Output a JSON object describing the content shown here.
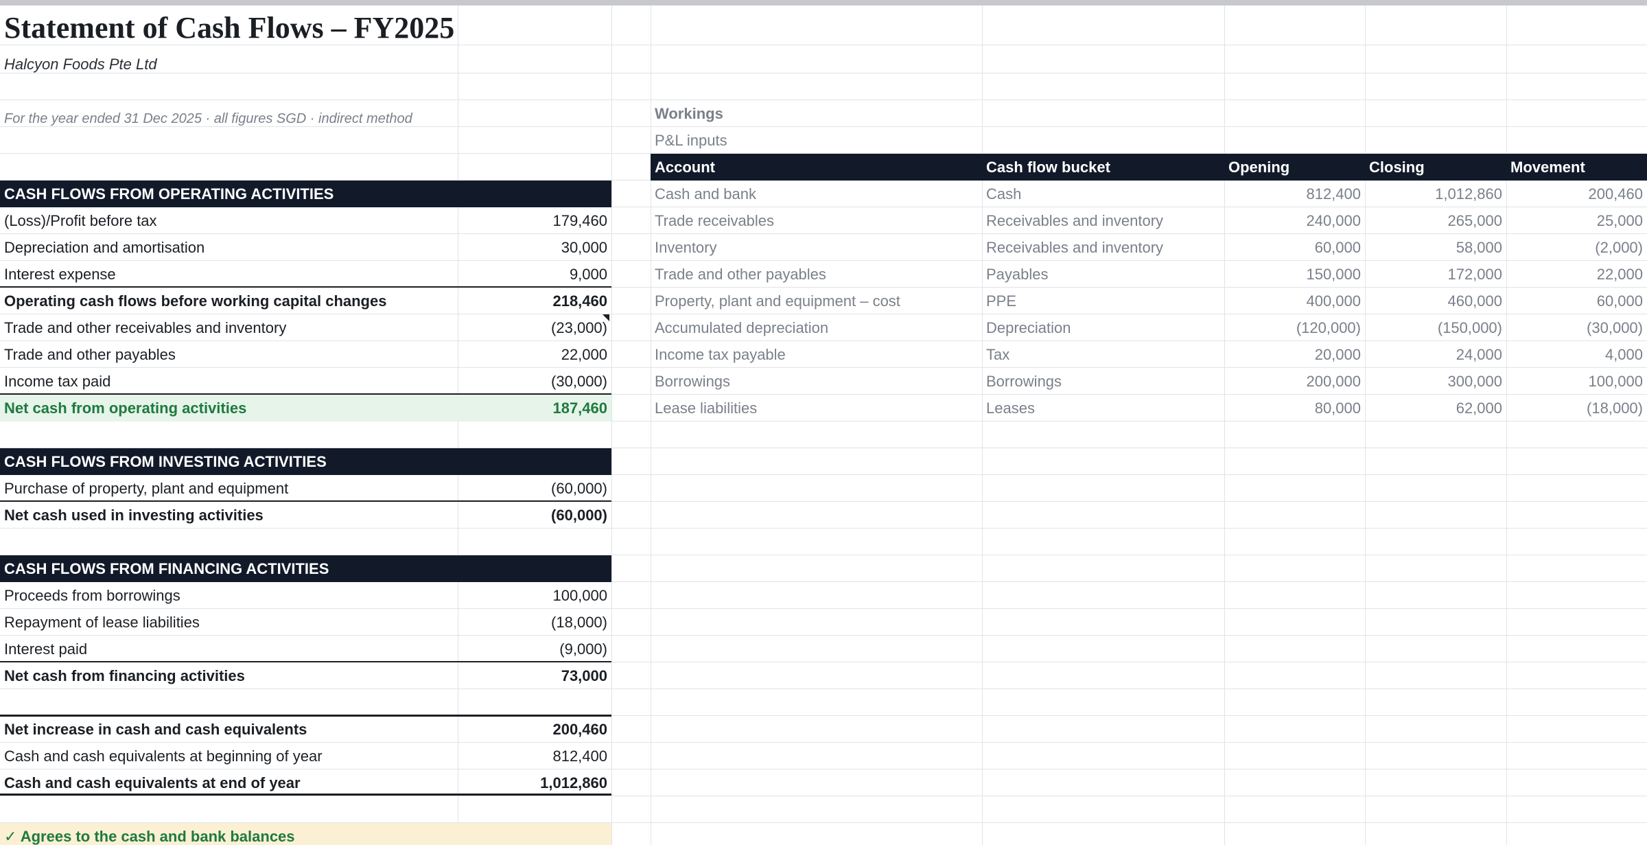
{
  "statement": {
    "title": "Statement of Cash Flows – FY2025",
    "company": "Halcyon Foods Pte Ltd",
    "note": "For the year ended 31 Dec 2025  ·  all figures SGD  ·  indirect method",
    "operating": {
      "header": "CASH FLOWS FROM OPERATING ACTIVITIES",
      "rows": [
        {
          "label": "(Loss)/Profit before tax",
          "value": "179,460"
        },
        {
          "label": "Depreciation and amortisation",
          "value": "30,000"
        },
        {
          "label": "Interest expense",
          "value": "9,000"
        },
        {
          "label": "Operating cash flows before working capital changes",
          "value": "218,460"
        },
        {
          "label": "Trade and other receivables and inventory",
          "value": "(23,000)"
        },
        {
          "label": "Trade and other payables",
          "value": "22,000"
        },
        {
          "label": "Income tax paid",
          "value": "(30,000)"
        },
        {
          "label": "Net cash from operating activities",
          "value": "187,460"
        }
      ]
    },
    "investing": {
      "header": "CASH FLOWS FROM INVESTING ACTIVITIES",
      "rows": [
        {
          "label": "Purchase of property, plant and equipment",
          "value": "(60,000)"
        },
        {
          "label": "Net cash used in investing activities",
          "value": "(60,000)"
        }
      ]
    },
    "financing": {
      "header": "CASH FLOWS FROM FINANCING ACTIVITIES",
      "rows": [
        {
          "label": "Proceeds from borrowings",
          "value": "100,000"
        },
        {
          "label": "Repayment of lease liabilities",
          "value": "(18,000)"
        },
        {
          "label": "Interest paid",
          "value": "(9,000)"
        },
        {
          "label": "Net cash from financing activities",
          "value": "73,000"
        }
      ]
    },
    "summary": {
      "rows": [
        {
          "label": "Net increase in cash and cash equivalents",
          "value": "200,460"
        },
        {
          "label": "Cash and cash equivalents at beginning of year",
          "value": "812,400"
        },
        {
          "label": "Cash and cash equivalents at end of year",
          "value": "1,012,860"
        }
      ]
    },
    "check": "✓ Agrees to the cash and bank balances"
  },
  "workings": {
    "title": "Workings",
    "subtitle": "P&L inputs",
    "columns": [
      "Account",
      "Cash flow bucket",
      "Opening",
      "Closing",
      "Movement"
    ],
    "rows": [
      {
        "account": "Cash and bank",
        "bucket": "Cash",
        "opening": "812,400",
        "closing": "1,012,860",
        "movement": "200,460"
      },
      {
        "account": "Trade receivables",
        "bucket": "Receivables and inventory",
        "opening": "240,000",
        "closing": "265,000",
        "movement": "25,000"
      },
      {
        "account": "Inventory",
        "bucket": "Receivables and inventory",
        "opening": "60,000",
        "closing": "58,000",
        "movement": "(2,000)"
      },
      {
        "account": "Trade and other payables",
        "bucket": "Payables",
        "opening": "150,000",
        "closing": "172,000",
        "movement": "22,000"
      },
      {
        "account": "Property, plant and equipment – cost",
        "bucket": "PPE",
        "opening": "400,000",
        "closing": "460,000",
        "movement": "60,000"
      },
      {
        "account": "Accumulated depreciation",
        "bucket": "Depreciation",
        "opening": "(120,000)",
        "closing": "(150,000)",
        "movement": "(30,000)"
      },
      {
        "account": "Income tax payable",
        "bucket": "Tax",
        "opening": "20,000",
        "closing": "24,000",
        "movement": "4,000"
      },
      {
        "account": "Borrowings",
        "bucket": "Borrowings",
        "opening": "200,000",
        "closing": "300,000",
        "movement": "100,000"
      },
      {
        "account": "Lease liabilities",
        "bucket": "Leases",
        "opening": "80,000",
        "closing": "62,000",
        "movement": "(18,000)"
      }
    ]
  }
}
